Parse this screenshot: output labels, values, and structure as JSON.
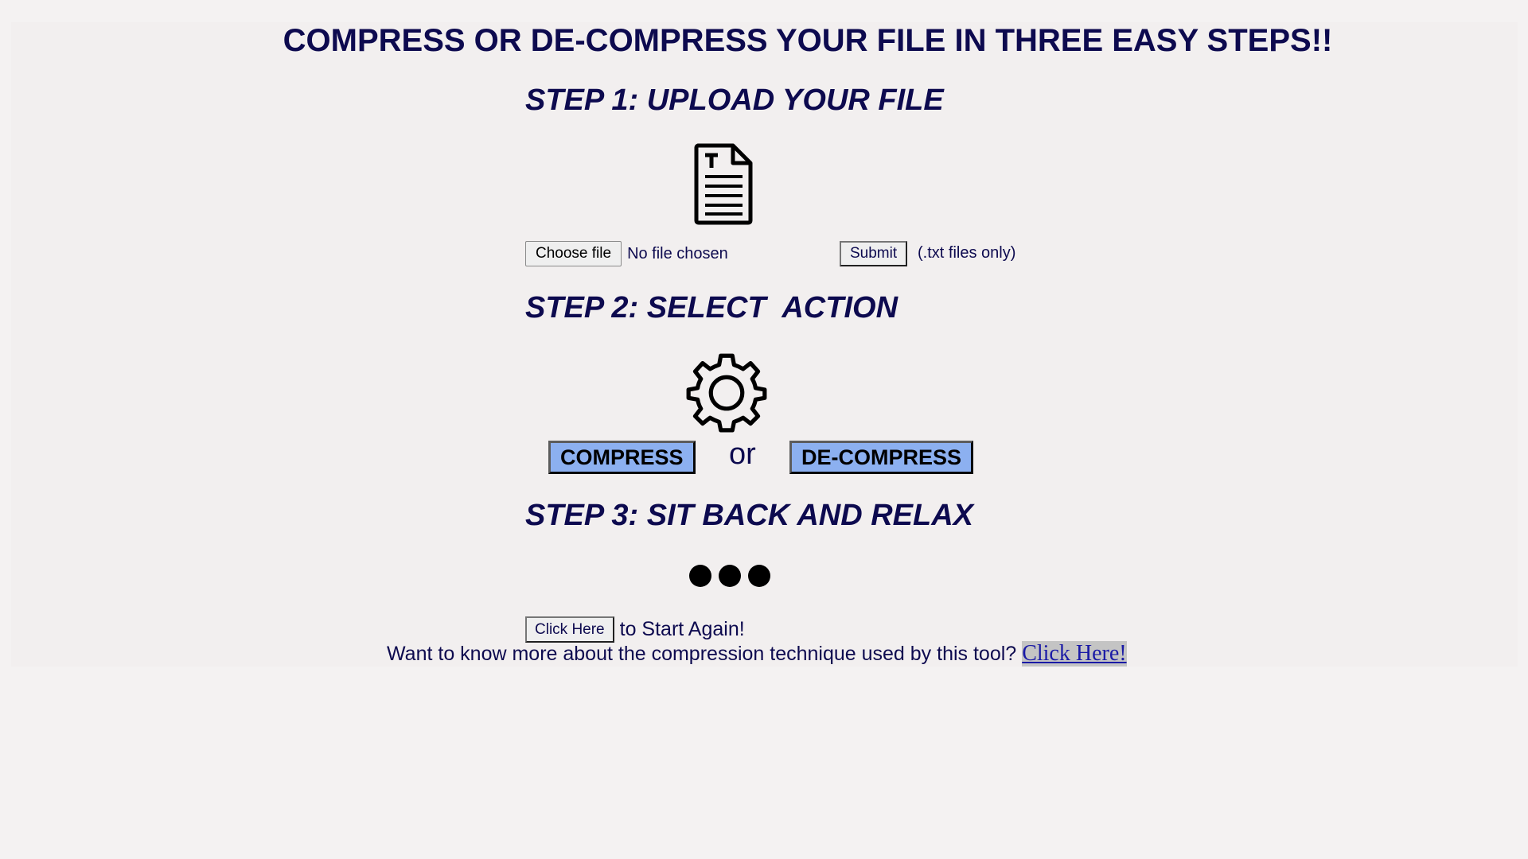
{
  "header": {
    "title": "COMPRESS OR DE-COMPRESS YOUR FILE IN THREE EASY STEPS!!"
  },
  "step1": {
    "heading": "STEP 1: UPLOAD YOUR FILE",
    "icon": "text-file-icon",
    "choose_label": "Choose file",
    "no_file_text": "No file chosen",
    "submit_label": "Submit",
    "hint": "(.txt files only)"
  },
  "step2": {
    "heading": "STEP 2: SELECT  ACTION",
    "icon": "gear-icon",
    "compress_label": "COMPRESS",
    "or_text": "or",
    "decompress_label": "DE-COMPRESS",
    "button_color": "#8cb0f0"
  },
  "step3": {
    "heading": "STEP 3: SIT BACK AND RELAX",
    "icon": "ellipsis-dots-icon"
  },
  "footer": {
    "restart_button_label": "Click Here",
    "restart_text": "to Start Again!",
    "learn_more_text": "Want to know more about the compression technique used by this tool?",
    "learn_more_link": "Click Here!"
  },
  "colors": {
    "text": "#0d0a4f",
    "background": "#f4f2f2",
    "link": "#1a1aa6"
  }
}
